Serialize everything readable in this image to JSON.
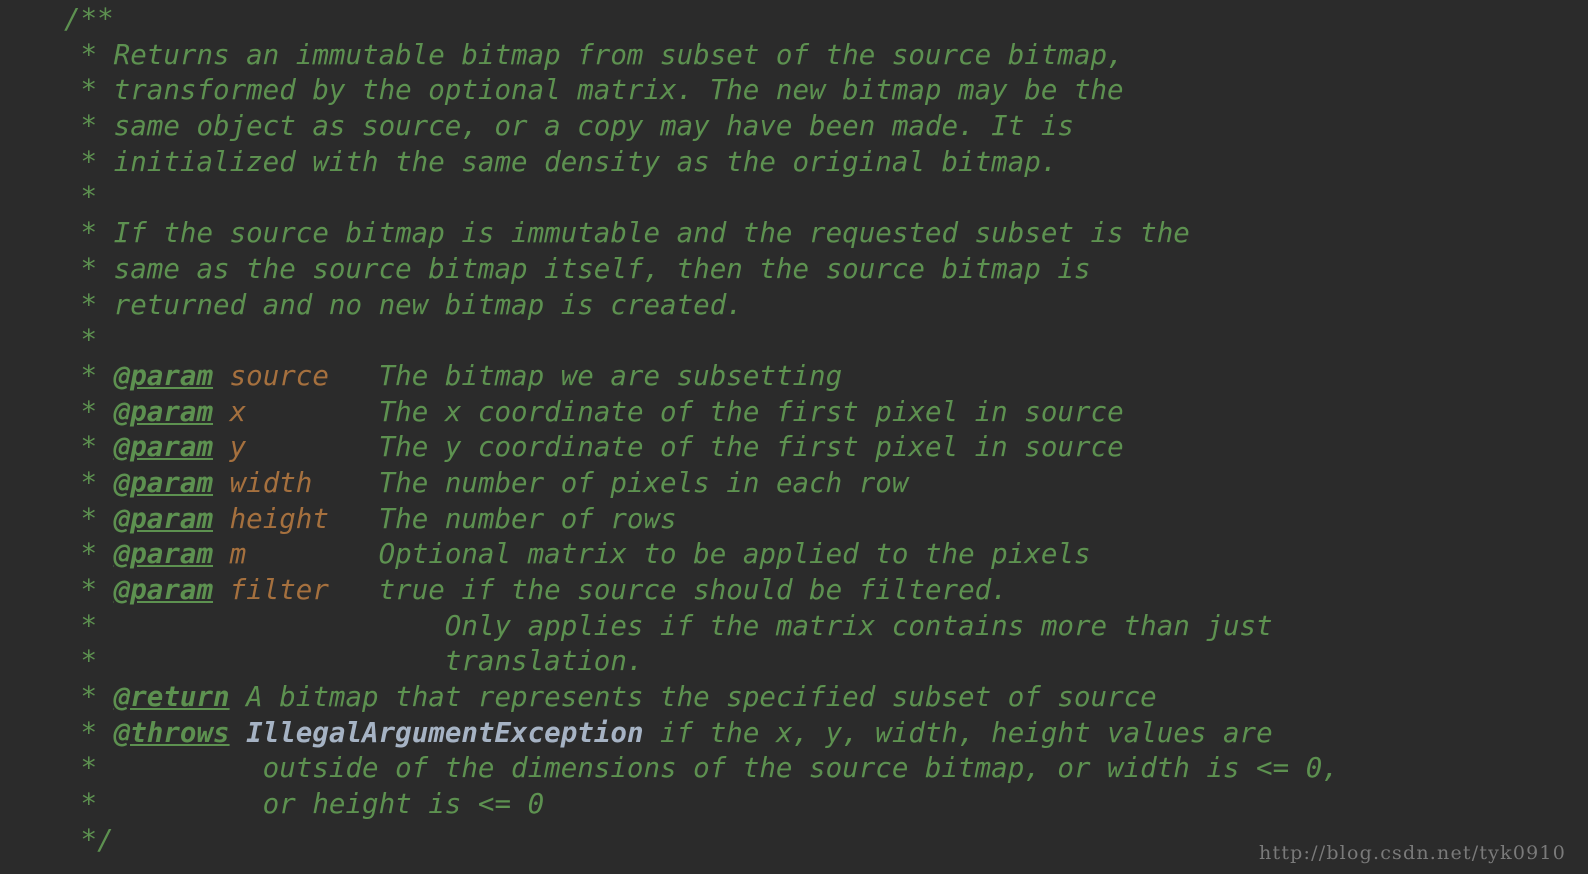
{
  "editor": {
    "background_color": "#2b2b2b",
    "comment_color": "#5d9150",
    "tag_color": "#5d9150",
    "param_name_color": "#a5703e",
    "type_color": "#a6b3c4",
    "language": "java",
    "comment_block": {
      "open": "/**",
      "close": " */"
    }
  },
  "lines": [
    {
      "id": "l01",
      "kind": "open",
      "text": "/**"
    },
    {
      "id": "l02",
      "kind": "text",
      "prefix": " * ",
      "text": "Returns an immutable bitmap from subset of the source bitmap,"
    },
    {
      "id": "l03",
      "kind": "text",
      "prefix": " * ",
      "text": "transformed by the optional matrix. The new bitmap may be the"
    },
    {
      "id": "l04",
      "kind": "text",
      "prefix": " * ",
      "text": "same object as source, or a copy may have been made. It is"
    },
    {
      "id": "l05",
      "kind": "text",
      "prefix": " * ",
      "text": "initialized with the same density as the original bitmap."
    },
    {
      "id": "l06",
      "kind": "text",
      "prefix": " *",
      "text": ""
    },
    {
      "id": "l07",
      "kind": "text",
      "prefix": " * ",
      "text": "If the source bitmap is immutable and the requested subset is the"
    },
    {
      "id": "l08",
      "kind": "text",
      "prefix": " * ",
      "text": "same as the source bitmap itself, then the source bitmap is"
    },
    {
      "id": "l09",
      "kind": "text",
      "prefix": " * ",
      "text": "returned and no new bitmap is created."
    },
    {
      "id": "l10",
      "kind": "text",
      "prefix": " *",
      "text": ""
    },
    {
      "id": "l11",
      "kind": "param",
      "prefix": " * ",
      "tag": "@param",
      "name": "source",
      "gap": "   ",
      "text": "The bitmap we are subsetting"
    },
    {
      "id": "l12",
      "kind": "param",
      "prefix": " * ",
      "tag": "@param",
      "name": "x",
      "gap": "        ",
      "text": "The x coordinate of the first pixel in source"
    },
    {
      "id": "l13",
      "kind": "param",
      "prefix": " * ",
      "tag": "@param",
      "name": "y",
      "gap": "        ",
      "text": "The y coordinate of the first pixel in source"
    },
    {
      "id": "l14",
      "kind": "param",
      "prefix": " * ",
      "tag": "@param",
      "name": "width",
      "gap": "    ",
      "text": "The number of pixels in each row"
    },
    {
      "id": "l15",
      "kind": "param",
      "prefix": " * ",
      "tag": "@param",
      "name": "height",
      "gap": "   ",
      "text": "The number of rows"
    },
    {
      "id": "l16",
      "kind": "param",
      "prefix": " * ",
      "tag": "@param",
      "name": "m",
      "gap": "        ",
      "text": "Optional matrix to be applied to the pixels"
    },
    {
      "id": "l17",
      "kind": "param",
      "prefix": " * ",
      "tag": "@param",
      "name": "filter",
      "gap": "   ",
      "text": "true if the source should be filtered."
    },
    {
      "id": "l18",
      "kind": "text",
      "prefix": " *",
      "text": "                     Only applies if the matrix contains more than just"
    },
    {
      "id": "l19",
      "kind": "text",
      "prefix": " *",
      "text": "                     translation."
    },
    {
      "id": "l20",
      "kind": "tagline",
      "prefix": " * ",
      "tag": "@return",
      "text": " A bitmap that represents the specified subset of source"
    },
    {
      "id": "l21",
      "kind": "throws",
      "prefix": " * ",
      "tag": "@throws",
      "type": "IllegalArgumentException",
      "text": " if the x, y, width, height values are"
    },
    {
      "id": "l22",
      "kind": "text",
      "prefix": " *",
      "text": "          outside of the dimensions of the source bitmap, or width is <= 0,"
    },
    {
      "id": "l23",
      "kind": "text",
      "prefix": " *",
      "text": "          or height is <= 0"
    },
    {
      "id": "l24",
      "kind": "close",
      "text": " */"
    }
  ],
  "watermark": {
    "text": "http://blog.csdn.net/tyk0910"
  }
}
